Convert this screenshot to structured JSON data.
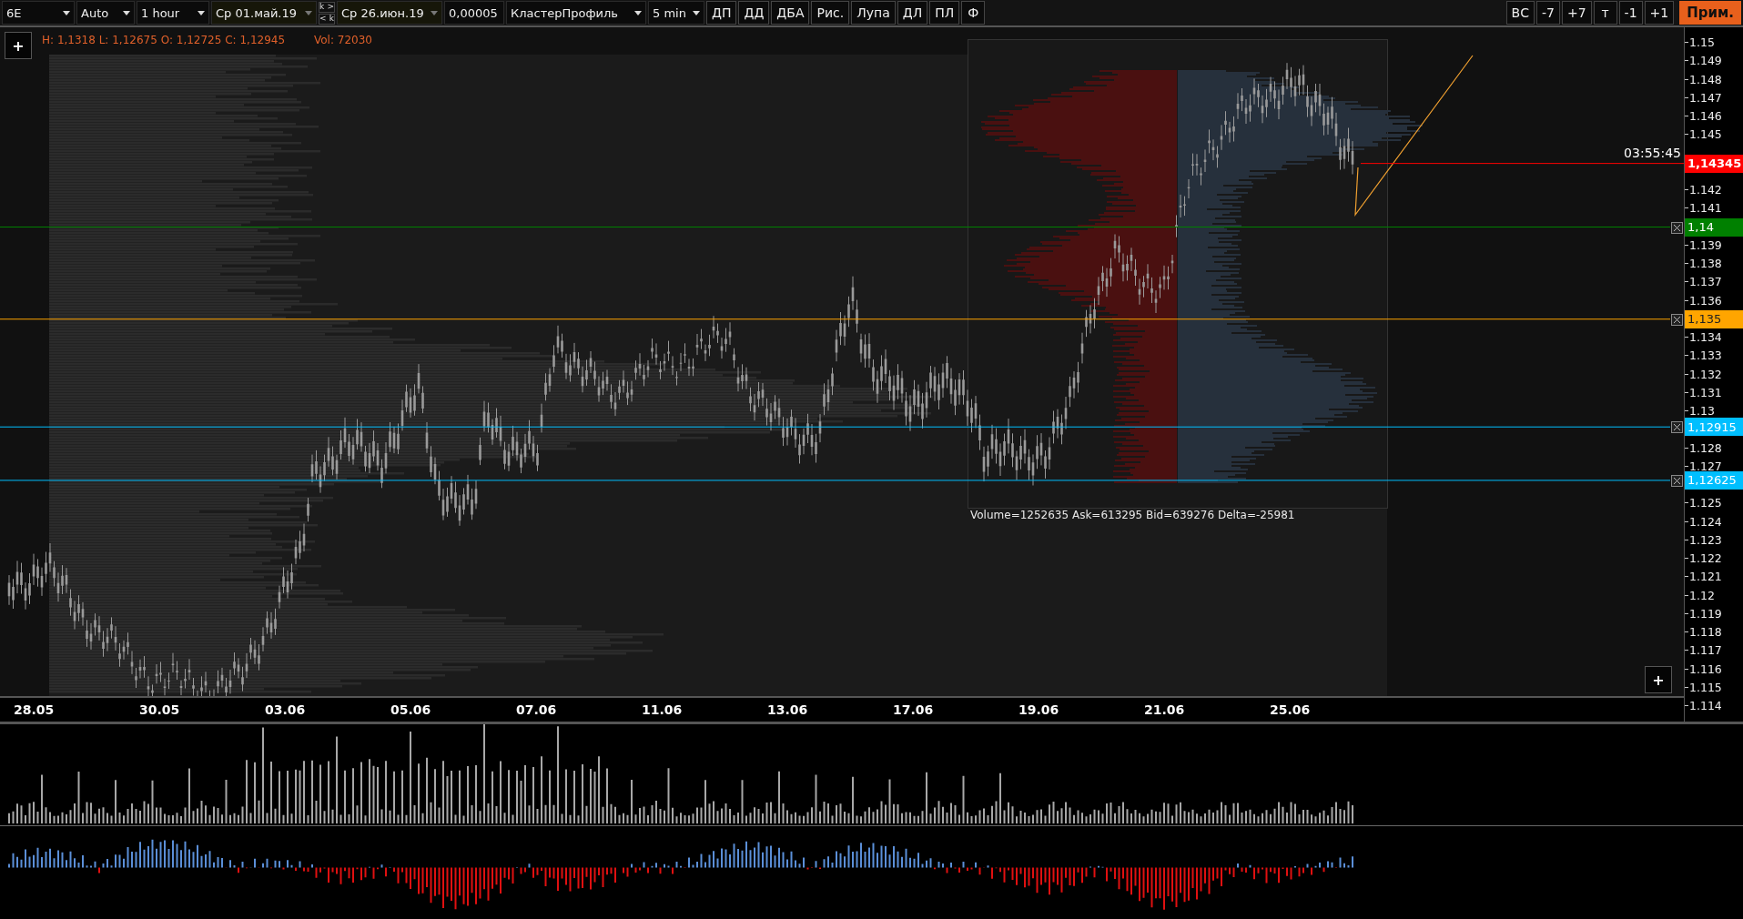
{
  "toolbar": {
    "instrument": {
      "value": "6E"
    },
    "scale": {
      "value": "Auto"
    },
    "timeframe": {
      "value": "1 hour"
    },
    "date_from": {
      "value": "Ср 01.май.19"
    },
    "nav_buttons": [
      {
        "left": "k",
        "right": ">"
      },
      {
        "left": "<",
        "right": "k"
      }
    ],
    "date_to": {
      "value": "Ср 26.июн.19"
    },
    "tick_size": {
      "value": "0,00005"
    },
    "profile_type": {
      "value": "КластерПрофиль"
    },
    "profile_period": {
      "value": "5 min"
    },
    "tools": [
      "ДП",
      "ДД",
      "ДБА",
      "Рис.",
      "Лупа",
      "ДЛ",
      "ПЛ",
      "Ф"
    ],
    "shift_buttons": [
      {
        "label": "ВС"
      },
      {
        "label": "-7"
      },
      {
        "label": "+7"
      },
      {
        "label": "т"
      },
      {
        "label": "-1"
      },
      {
        "label": "+1"
      }
    ],
    "apply_button": "Прим."
  },
  "chart": {
    "add_buttons": [
      "+",
      "+"
    ],
    "ohlc": "H: 1,1318 L: 1,12675 O: 1,12725 C: 1,12945",
    "volume": "Vol: 72030",
    "timer": "03:55:45",
    "profile_stats": "Volume=1252635  Ask=613295  Bid=639276  Delta=-25981",
    "levels": [
      {
        "price": "1,14345",
        "kind": "current",
        "color": "#ff0000"
      },
      {
        "price": "1,14",
        "kind": "level",
        "color": "#008000"
      },
      {
        "price": "1,135",
        "kind": "level",
        "color": "#ffa500"
      },
      {
        "price": "1,12915",
        "kind": "level",
        "color": "#00bfff"
      },
      {
        "price": "1,12625",
        "kind": "level",
        "color": "#00bfff"
      }
    ],
    "price_ticks": [
      "1.15",
      "1.149",
      "1.148",
      "1.147",
      "1.146",
      "1.145",
      "1.142",
      "1.141",
      "1.139",
      "1.138",
      "1.137",
      "1.136",
      "1.134",
      "1.133",
      "1.132",
      "1.131",
      "1.13",
      "1.128",
      "1.127",
      "1.125",
      "1.124",
      "1.123",
      "1.122",
      "1.121",
      "1.12",
      "1.119",
      "1.118",
      "1.117",
      "1.116",
      "1.115",
      "1.114"
    ],
    "time_labels": [
      "28.05",
      "30.05",
      "03.06",
      "05.06",
      "07.06",
      "11.06",
      "13.06",
      "17.06",
      "19.06",
      "21.06",
      "25.06"
    ]
  }
}
